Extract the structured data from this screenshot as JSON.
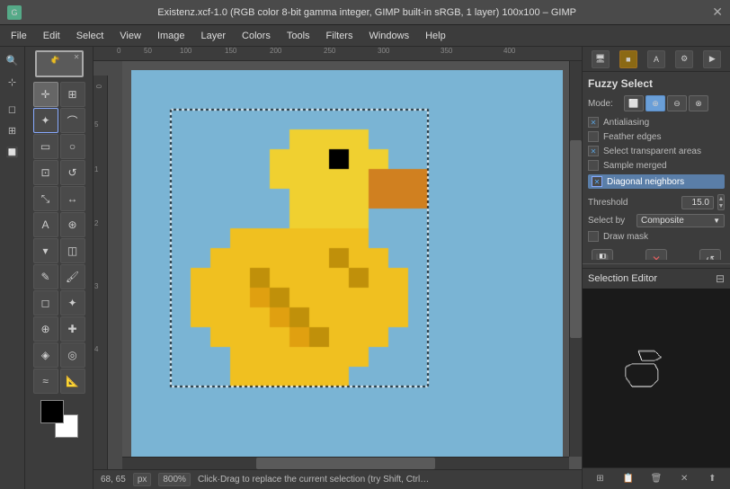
{
  "window": {
    "title": "Existenz.xcf-1.0 (RGB color 8-bit gamma integer, GIMP built-in sRGB, 1 layer) 100x100 – GIMP",
    "close_label": "✕"
  },
  "menu": {
    "items": [
      "File",
      "Edit",
      "Select",
      "View",
      "Image",
      "Layer",
      "Colors",
      "Tools",
      "Filters",
      "Windows",
      "Help"
    ]
  },
  "toolbox": {
    "tools": [
      {
        "name": "move",
        "icon": "✛"
      },
      {
        "name": "scale",
        "icon": "⊞"
      },
      {
        "name": "fuzzy-select",
        "icon": "⊹"
      },
      {
        "name": "free-select",
        "icon": "✓"
      },
      {
        "name": "rect-select",
        "icon": "▭"
      },
      {
        "name": "ellipse-select",
        "icon": "○"
      },
      {
        "name": "crop",
        "icon": "⊡"
      },
      {
        "name": "rotate",
        "icon": "↺"
      },
      {
        "name": "flip",
        "icon": "↔"
      },
      {
        "name": "text",
        "icon": "A"
      },
      {
        "name": "bucket-fill",
        "icon": "▾"
      },
      {
        "name": "gradient",
        "icon": "◫"
      },
      {
        "name": "pencil",
        "icon": "✎"
      },
      {
        "name": "brush",
        "icon": "🖌"
      },
      {
        "name": "eraser",
        "icon": "◻"
      },
      {
        "name": "airbrush",
        "icon": "✦"
      },
      {
        "name": "clone",
        "icon": "⊕"
      },
      {
        "name": "heal",
        "icon": "✚"
      },
      {
        "name": "blend",
        "icon": "◈"
      },
      {
        "name": "dodge",
        "icon": "◎"
      },
      {
        "name": "smudge",
        "icon": "≈"
      },
      {
        "name": "measure",
        "icon": "📐"
      },
      {
        "name": "color-picker",
        "icon": "✒"
      }
    ]
  },
  "right_panel": {
    "icons": [
      "🖥",
      "🟫",
      "A",
      "⚙",
      "▶"
    ],
    "fuzzy_select": {
      "title": "Fuzzy Select",
      "mode_label": "Mode:",
      "mode_buttons": [
        {
          "icon": "⬜",
          "active": false
        },
        {
          "icon": "⊕",
          "active": true
        },
        {
          "icon": "⊖",
          "active": false
        },
        {
          "icon": "⊗",
          "active": false
        }
      ],
      "antialiasing": {
        "label": "Antialiasing",
        "checked": true
      },
      "feather_edges": {
        "label": "Feather edges",
        "checked": false
      },
      "select_transparent": {
        "label": "Select transparent areas",
        "checked": true
      },
      "sample_merged": {
        "label": "Sample merged",
        "checked": false
      },
      "diagonal_neighbors": {
        "label": "Diagonal neighbors",
        "checked": true,
        "highlighted": true
      },
      "threshold_label": "Threshold",
      "threshold_value": "15.0",
      "select_by_label": "Select by",
      "select_by_value": "Composite",
      "draw_mask_label": "Draw mask",
      "action_buttons": [
        "💾",
        "✕",
        "↺"
      ],
      "dots": "···"
    },
    "selection_editor": {
      "title": "Selection Editor",
      "collapse_icon": "⊟"
    },
    "bottom_icons": [
      "⊞",
      "📋",
      "🗑",
      "✕",
      "⬆"
    ]
  },
  "status_bar": {
    "coords": "68, 65",
    "unit": "px",
    "zoom": "800%",
    "message": "Click·Drag to replace the current selection (try Shift, Ctrl…"
  },
  "colors": {
    "foreground": "#000000",
    "background": "#ffffff"
  }
}
